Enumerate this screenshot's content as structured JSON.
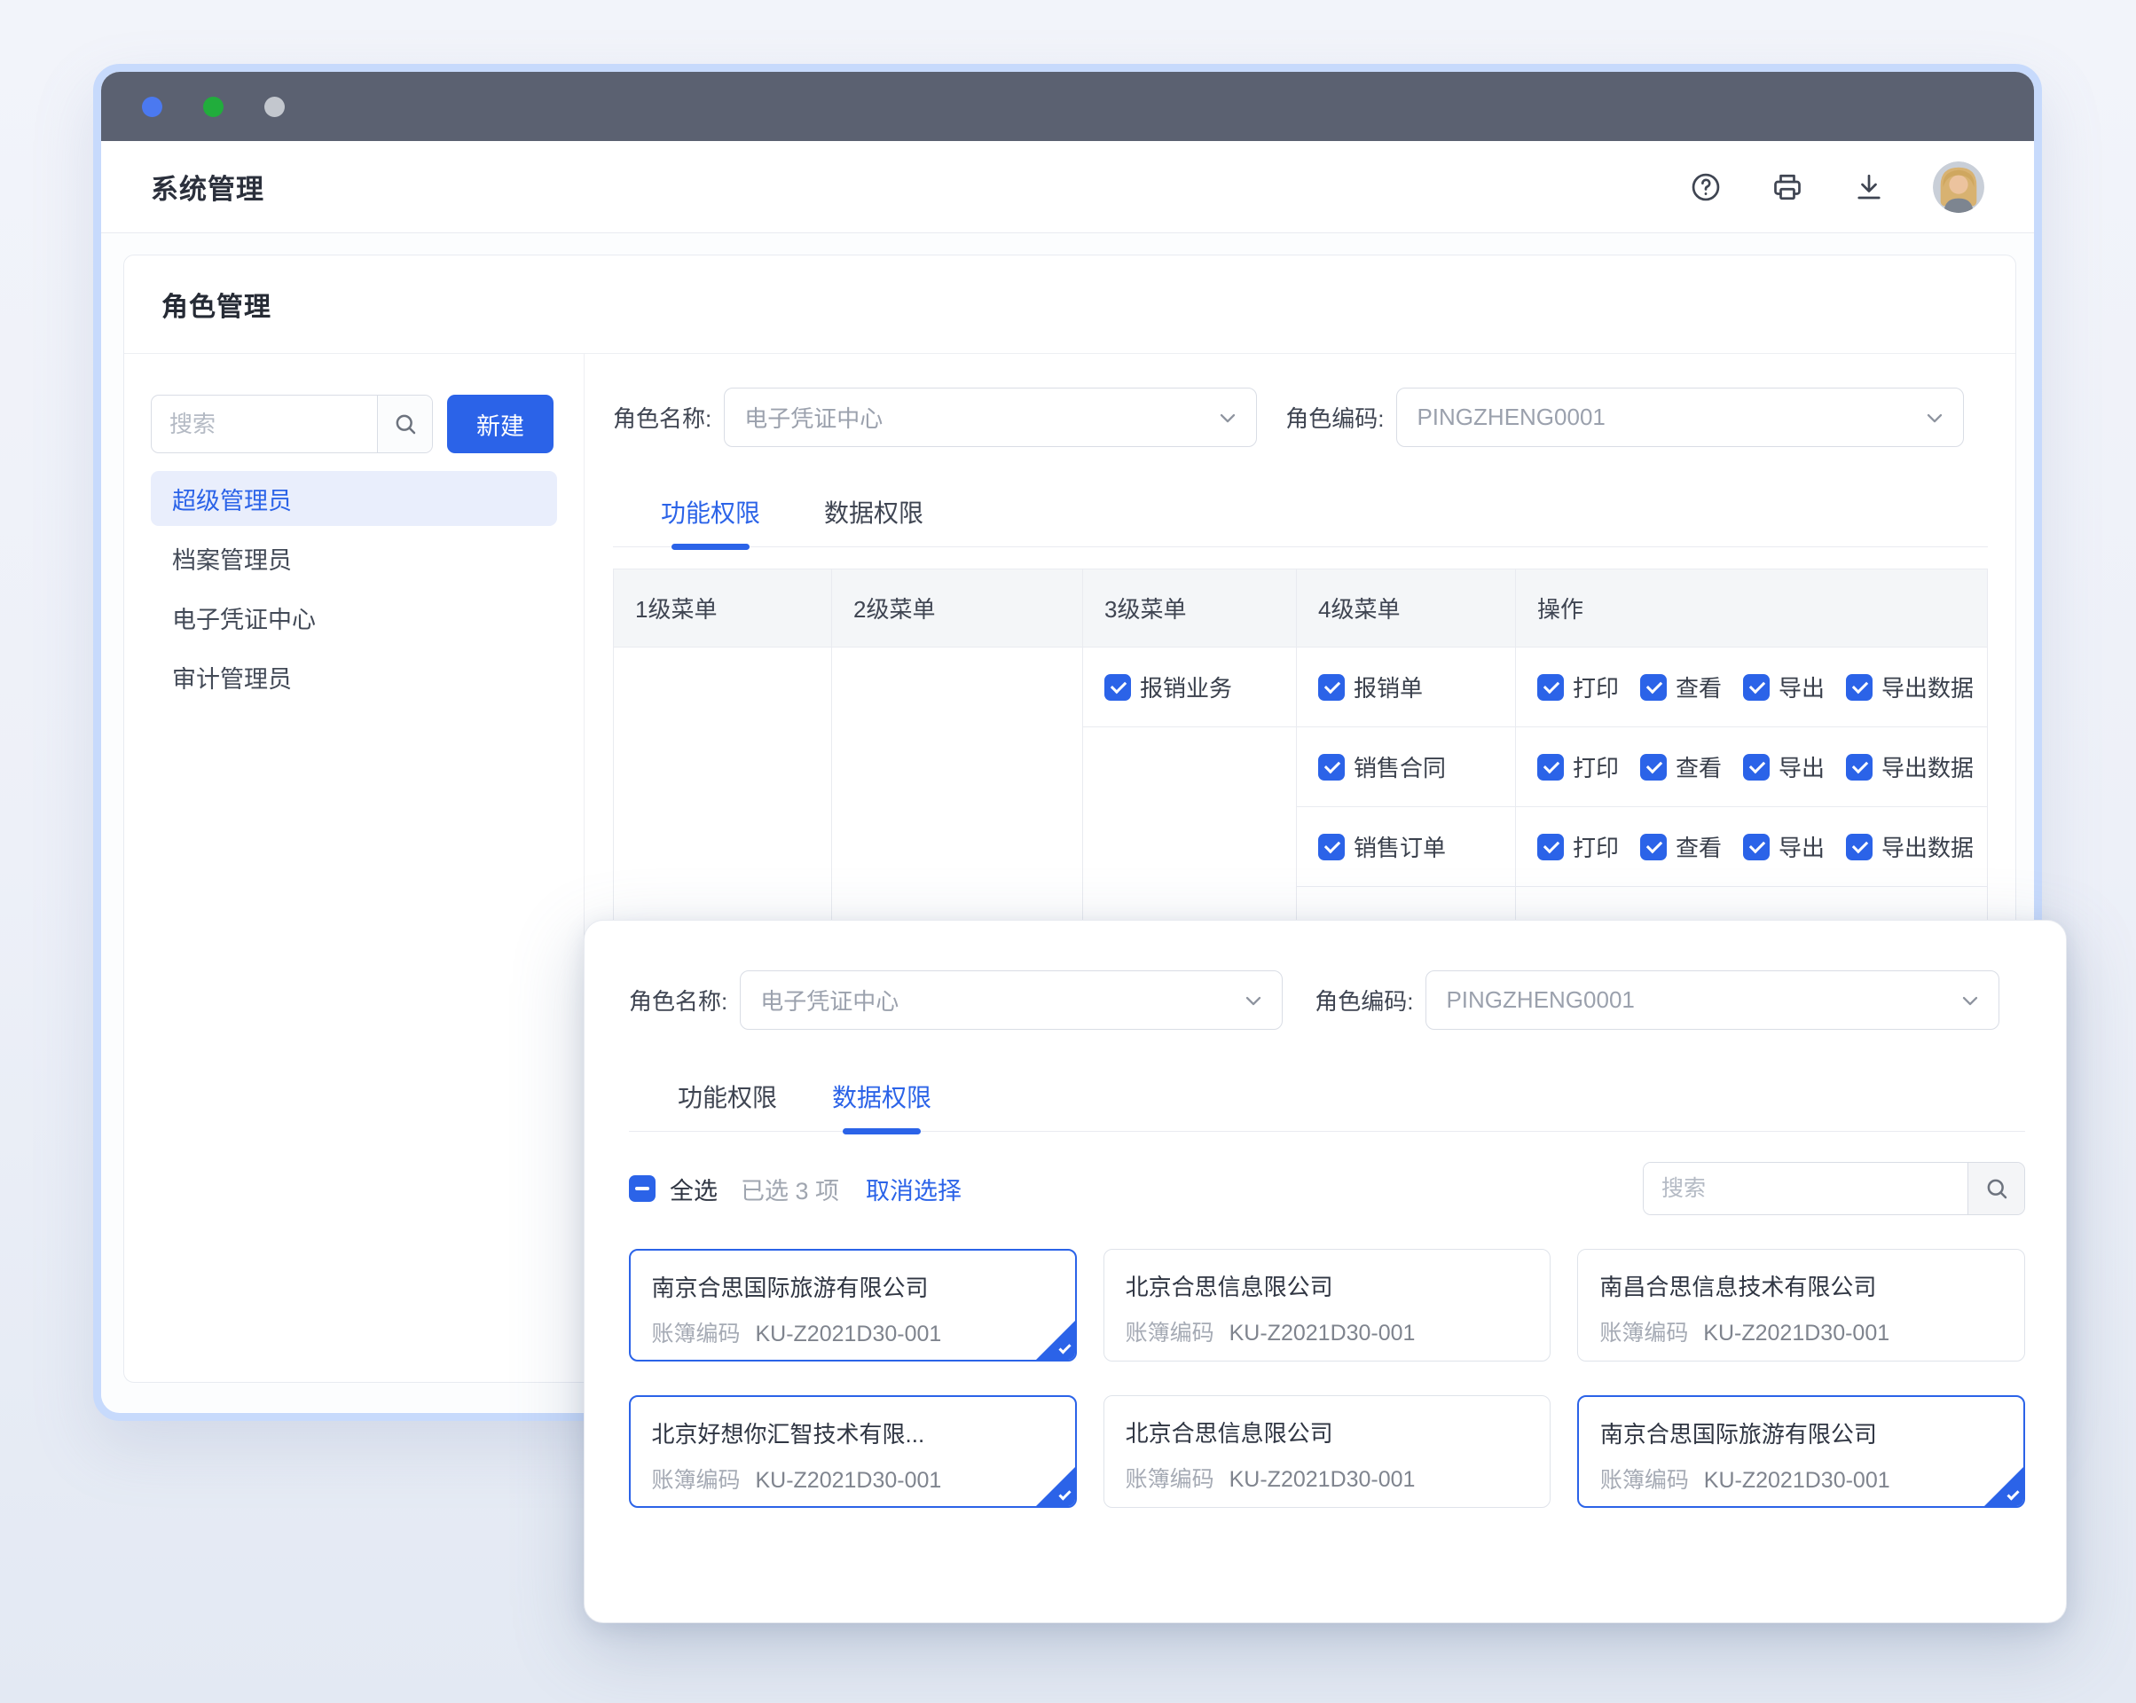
{
  "app": {
    "title": "系统管理"
  },
  "page": {
    "title": "角色管理"
  },
  "sidebar": {
    "search_placeholder": "搜索",
    "new_button_label": "新建",
    "roles": [
      {
        "label": "超级管理员",
        "active": true
      },
      {
        "label": "档案管理员",
        "active": false
      },
      {
        "label": "电子凭证中心",
        "active": false
      },
      {
        "label": "审计管理员",
        "active": false
      }
    ]
  },
  "role_form": {
    "name_label": "角色名称:",
    "name_value": "电子凭证中心",
    "code_label": "角色编码:",
    "code_value": "PINGZHENG0001"
  },
  "tabs": {
    "function_label": "功能权限",
    "data_label": "数据权限",
    "active": "功能权限"
  },
  "permission_table": {
    "headers": [
      "1级菜单",
      "2级菜单",
      "3级菜单",
      "4级菜单",
      "操作"
    ],
    "rows": [
      {
        "level3": "报销业务",
        "level4": "报销单",
        "operations": [
          "打印",
          "查看",
          "导出",
          "导出数据"
        ],
        "all_checked": true
      },
      {
        "level3": "",
        "level4": "销售合同",
        "operations": [
          "打印",
          "查看",
          "导出",
          "导出数据"
        ],
        "all_checked": true
      },
      {
        "level3": "",
        "level4": "销售订单",
        "operations": [
          "打印",
          "查看",
          "导出",
          "导出数据"
        ],
        "all_checked": true
      }
    ]
  },
  "modal": {
    "role_form": {
      "name_label": "角色名称:",
      "name_value": "电子凭证中心",
      "code_label": "角色编码:",
      "code_value": "PINGZHENG0001"
    },
    "tabs": {
      "function_label": "功能权限",
      "data_label": "数据权限",
      "active": "数据权限"
    },
    "selection": {
      "select_all_label": "全选",
      "selected_count": "已选 3 项",
      "clear_label": "取消选择",
      "search_placeholder": "搜索"
    },
    "companies": [
      {
        "name": "南京合思国际旅游有限公司",
        "code_label": "账簿编码",
        "code": "KU-Z2021D30-001",
        "selected": true
      },
      {
        "name": "北京合思信息限公司",
        "code_label": "账簿编码",
        "code": "KU-Z2021D30-001",
        "selected": false
      },
      {
        "name": "南昌合思信息技术有限公司",
        "code_label": "账簿编码",
        "code": "KU-Z2021D30-001",
        "selected": false
      },
      {
        "name": "北京好想你汇智技术有限...",
        "code_label": "账簿编码",
        "code": "KU-Z2021D30-001",
        "selected": true
      },
      {
        "name": "北京合思信息限公司",
        "code_label": "账簿编码",
        "code": "KU-Z2021D30-001",
        "selected": false
      },
      {
        "name": "南京合思国际旅游有限公司",
        "code_label": "账簿编码",
        "code": "KU-Z2021D30-001",
        "selected": true
      }
    ]
  },
  "colors": {
    "accent": "#2B63E8",
    "titlebar": "#5B6171",
    "window_border": "#C7DAFC",
    "selected_item_bg": "#E9EEFC",
    "dot_blue": "#4B79F0",
    "dot_green": "#21AD3C",
    "dot_gray": "#C3C7CE"
  }
}
